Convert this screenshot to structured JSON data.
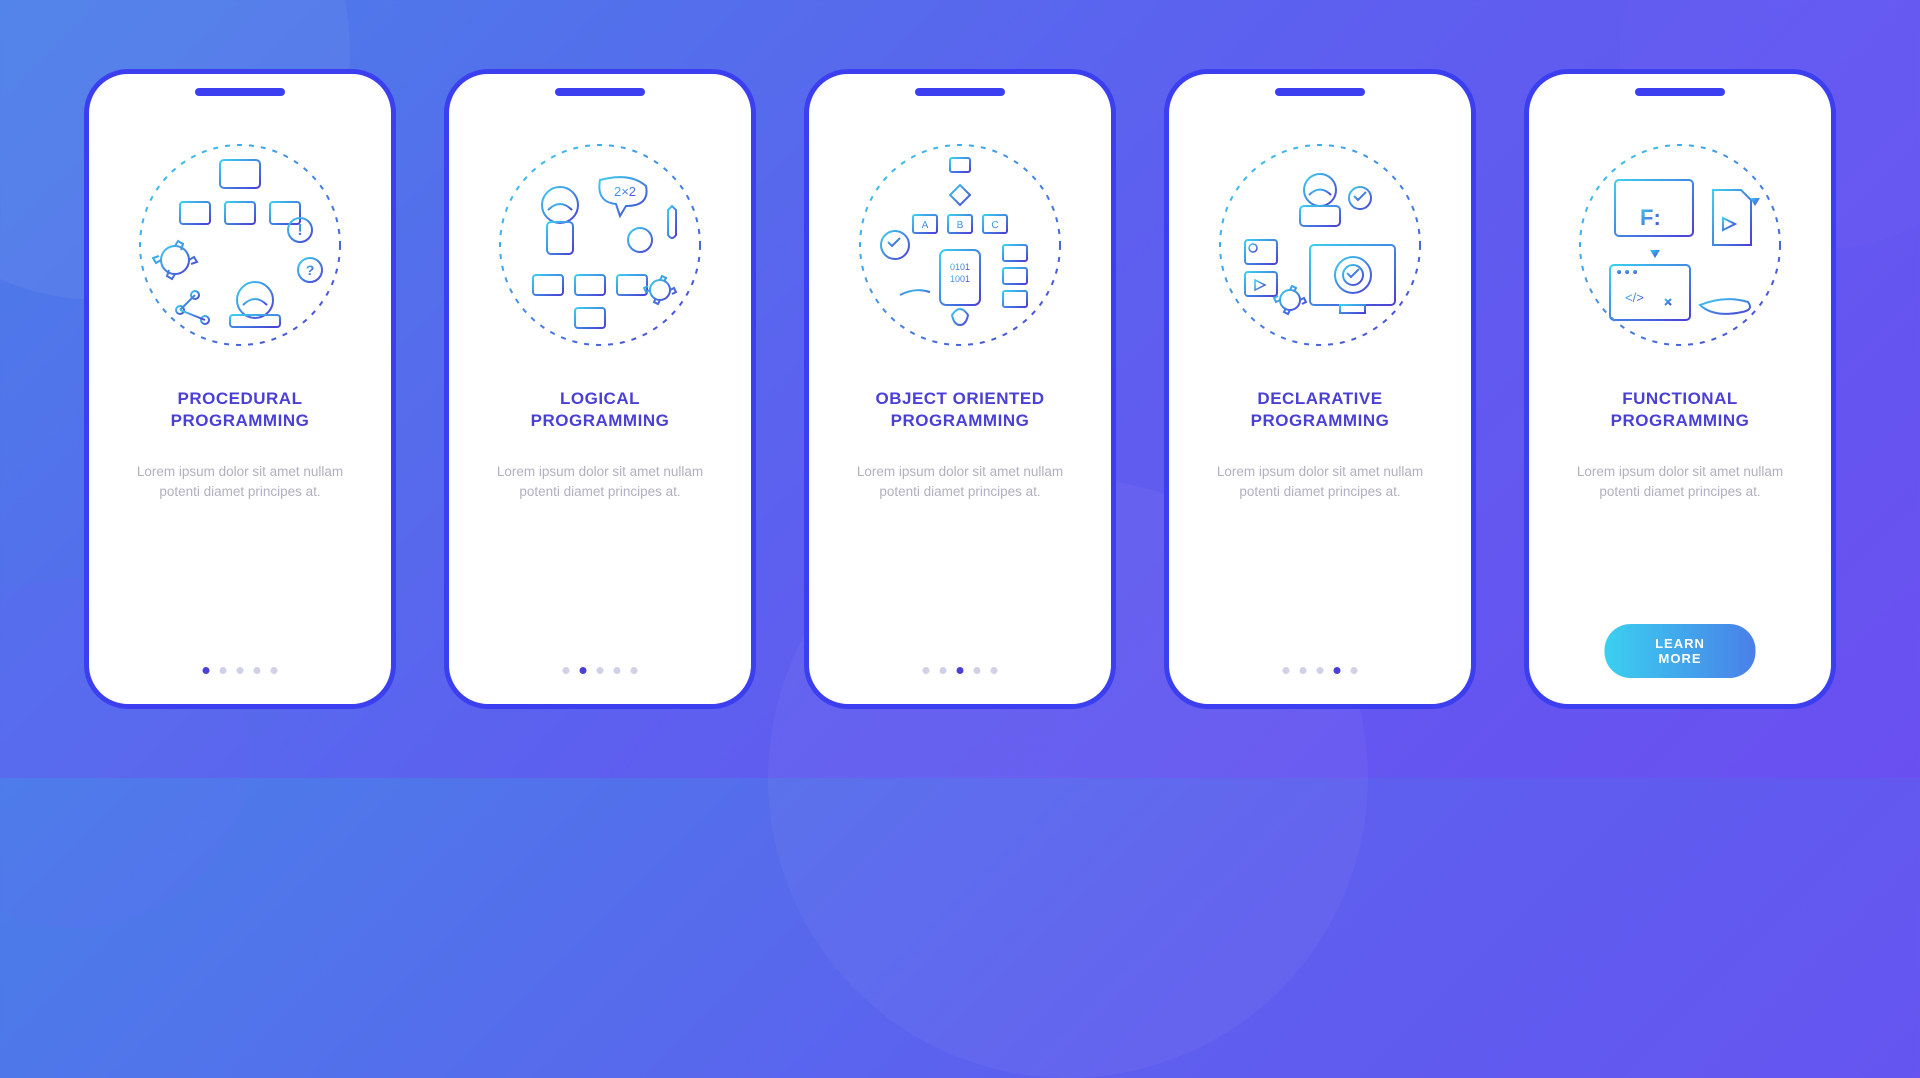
{
  "colors": {
    "accent": "#4a3fd6",
    "border": "#3b3ff0",
    "desc": "#b0b0c0",
    "cta_gradient_start": "#3ad0f0",
    "cta_gradient_end": "#4a7fe8"
  },
  "screens": [
    {
      "title": "PROCEDURAL\nPROGRAMMING",
      "description": "Lorem ipsum dolor sit amet nullam potenti diamet principes at.",
      "icon": "procedural-icon",
      "active_dot": 0
    },
    {
      "title": "LOGICAL\nPROGRAMMING",
      "description": "Lorem ipsum dolor sit amet nullam potenti diamet principes at.",
      "icon": "logical-icon",
      "active_dot": 1
    },
    {
      "title": "OBJECT ORIENTED\nPROGRAMMING",
      "description": "Lorem ipsum dolor sit amet nullam potenti diamet principes at.",
      "icon": "oop-icon",
      "active_dot": 2
    },
    {
      "title": "DECLARATIVE\nPROGRAMMING",
      "description": "Lorem ipsum dolor sit amet nullam potenti diamet principes at.",
      "icon": "declarative-icon",
      "active_dot": 3
    },
    {
      "title": "FUNCTIONAL\nPROGRAMMING",
      "description": "Lorem ipsum dolor sit amet nullam potenti diamet principes at.",
      "icon": "functional-icon",
      "active_dot": 4,
      "cta": "LEARN MORE"
    }
  ],
  "dot_count": 5
}
